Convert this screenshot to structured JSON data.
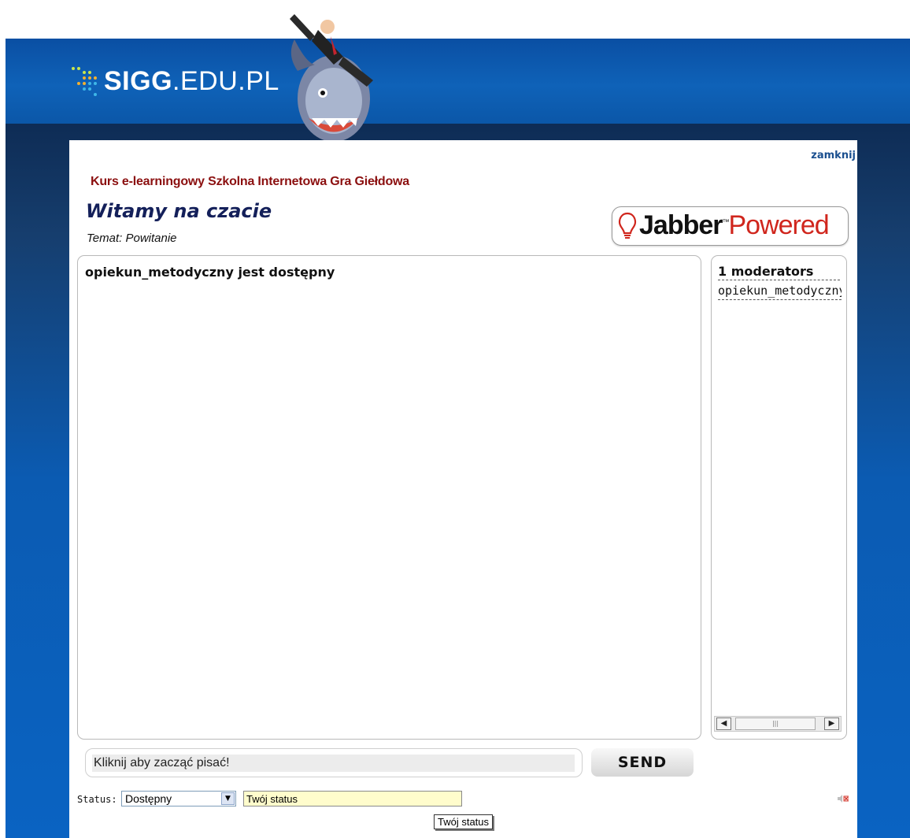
{
  "site": {
    "logo_bold": "SIGG",
    "logo_rest": ".EDU.PL"
  },
  "header": {
    "close_link": "zamknij",
    "course_title": "Kurs e-learningowy Szkolna Internetowa Gra Giełdowa",
    "room_title": "Witamy na czacie",
    "topic": "Temat: Powitanie"
  },
  "jabber_badge": {
    "word": "Jabber",
    "tm": "™",
    "powered": "Powered"
  },
  "chat": {
    "messages": [
      "opiekun_metodyczny jest dostępny"
    ]
  },
  "roster": {
    "header": "1 moderators",
    "users": [
      "opiekun_metodyczny"
    ]
  },
  "compose": {
    "placeholder": "Kliknij aby zacząć pisać!",
    "send_label": "SEND"
  },
  "status": {
    "label": "Status:",
    "selected": "Dostępny",
    "text_value": "Twój status",
    "tooltip": "Twój status"
  },
  "colors": {
    "accent_blue": "#0b5bb2",
    "course_red": "#8b0f0f",
    "room_navy": "#14205a",
    "link_blue": "#1a4f8f"
  }
}
